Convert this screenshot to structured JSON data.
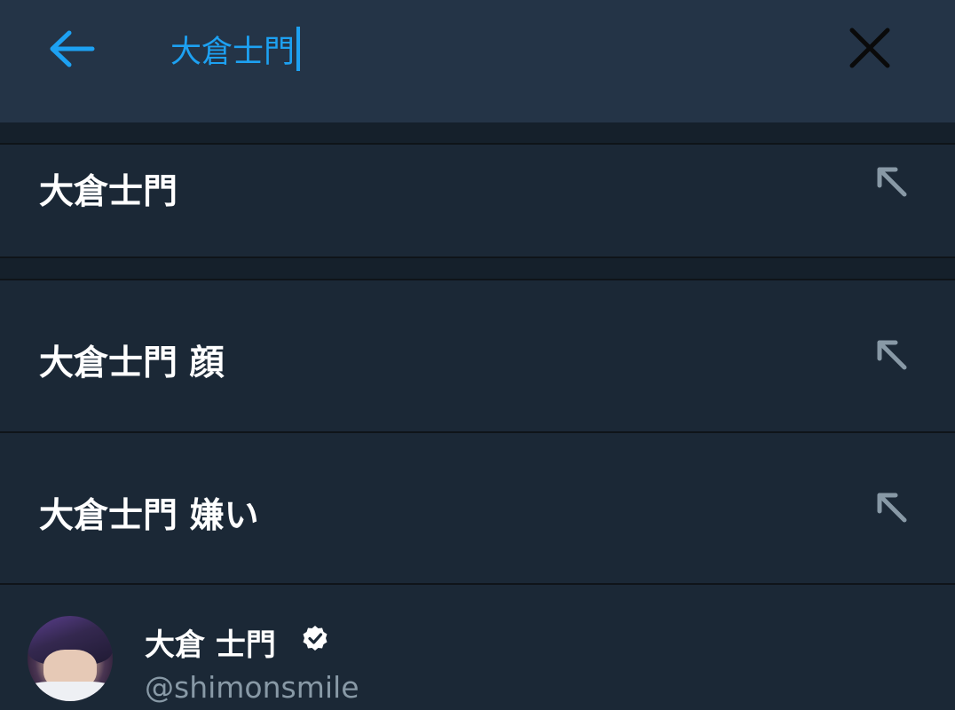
{
  "search": {
    "query": "大倉士門"
  },
  "suggestions": [
    {
      "label": "大倉士門",
      "icon": "arrow-up-left-icon"
    },
    {
      "label": "大倉士門 顔",
      "icon": "arrow-up-left-icon"
    },
    {
      "label": "大倉士門 嫌い",
      "icon": "arrow-up-left-icon"
    }
  ],
  "user": {
    "name": "大倉 士門",
    "handle": "@shimonsmile",
    "verified_icon": "verified-badge-icon"
  },
  "colors": {
    "accent": "#1da1f2",
    "header_bg": "#243447",
    "row_bg": "#1b2836",
    "band_bg": "#15202b",
    "secondary_text": "#8899a6"
  }
}
